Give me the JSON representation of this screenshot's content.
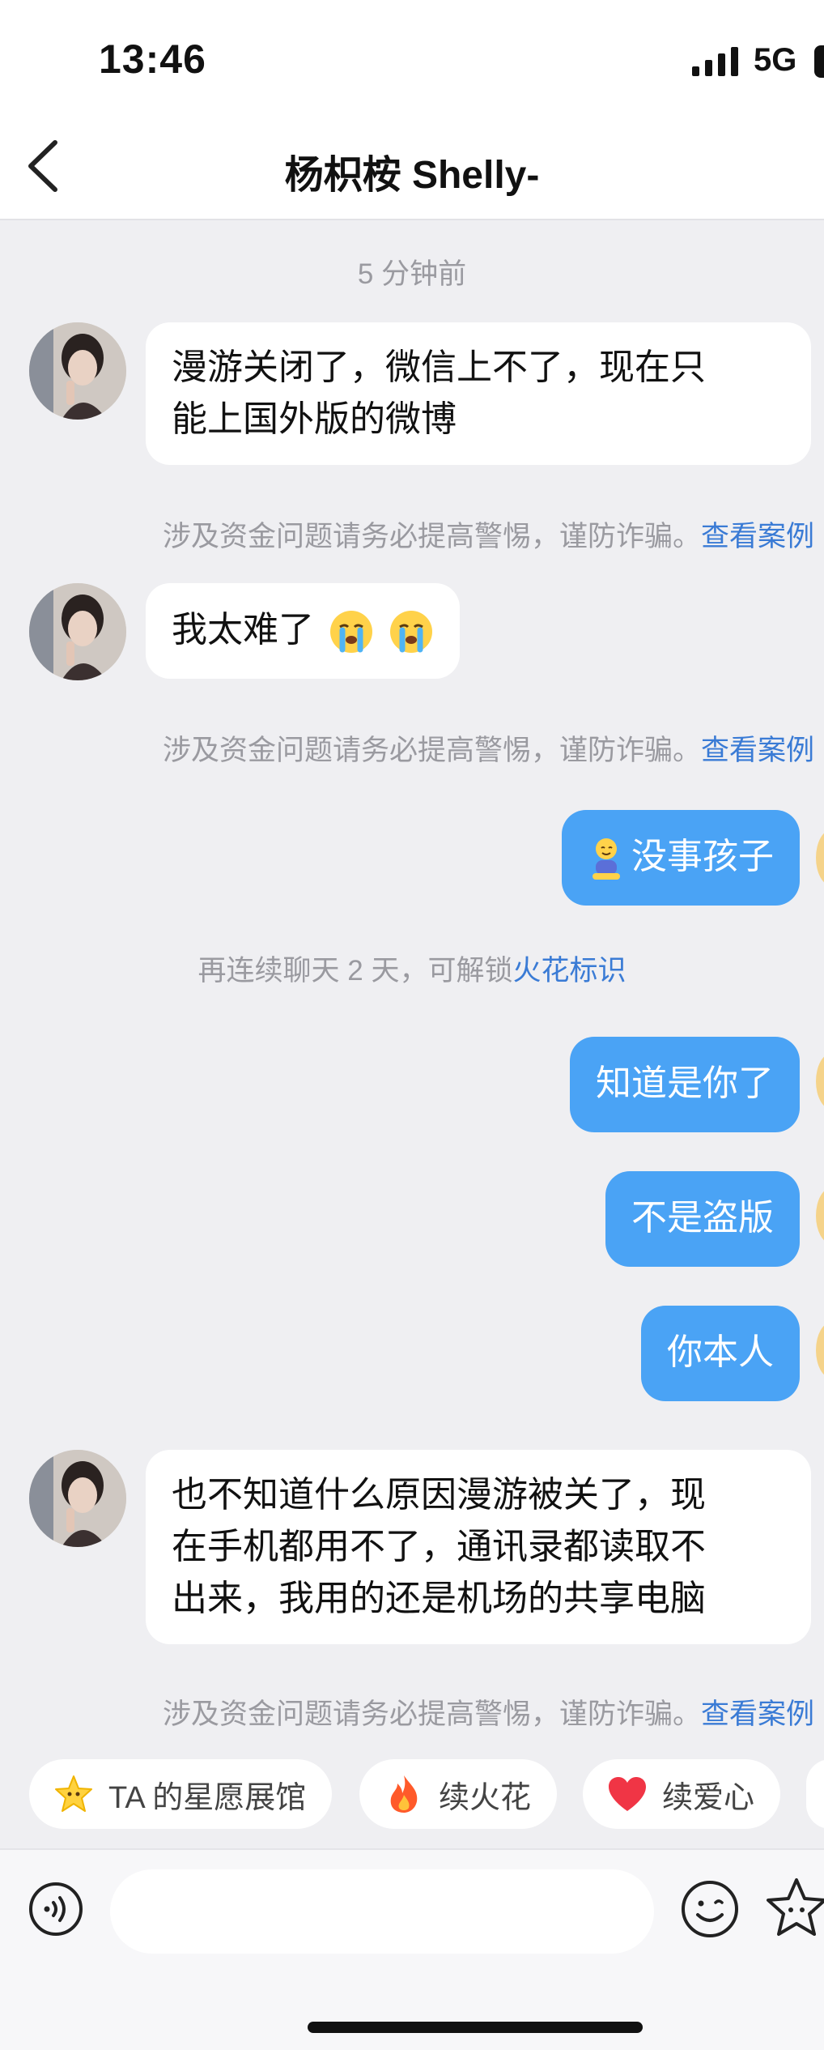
{
  "status_bar": {
    "time": "13:46",
    "network": "5G"
  },
  "header": {
    "title": "杨枳桉 Shelly-"
  },
  "chat": {
    "timestamp": "5 分钟前",
    "msg1": {
      "lines": [
        "漫游关闭了，微信上不了，现在只",
        "能上国外版的微博"
      ]
    },
    "warning": {
      "text": "涉及资金问题请务必提高警惕，谨防诈骗。",
      "link": "查看案例"
    },
    "msg2": {
      "text": "我太难了",
      "emoji": "crying-face"
    },
    "reply1": {
      "text": "没事孩子",
      "emoji": "sitting-figure"
    },
    "streak": {
      "text": "再连续聊天 2 天，可解锁",
      "link": "火花标识"
    },
    "reply2": {
      "text": "知道是你了"
    },
    "reply3": {
      "text": "不是盗版"
    },
    "reply4": {
      "text": "你本人"
    },
    "msg3": {
      "lines": [
        "也不知道什么原因漫游被关了，现",
        "在手机都用不了，通讯录都读取不",
        "出来，我用的还是机场的共享电脑"
      ]
    }
  },
  "chips": [
    {
      "label": "TA 的星愿展馆",
      "icon": "star-icon"
    },
    {
      "label": "续火花",
      "icon": "flame-icon"
    },
    {
      "label": "续爱心",
      "icon": "heart-icon"
    }
  ],
  "colors": {
    "accent": "#4aa3f5",
    "link": "#3a7bd5",
    "background": "#efeff2"
  }
}
